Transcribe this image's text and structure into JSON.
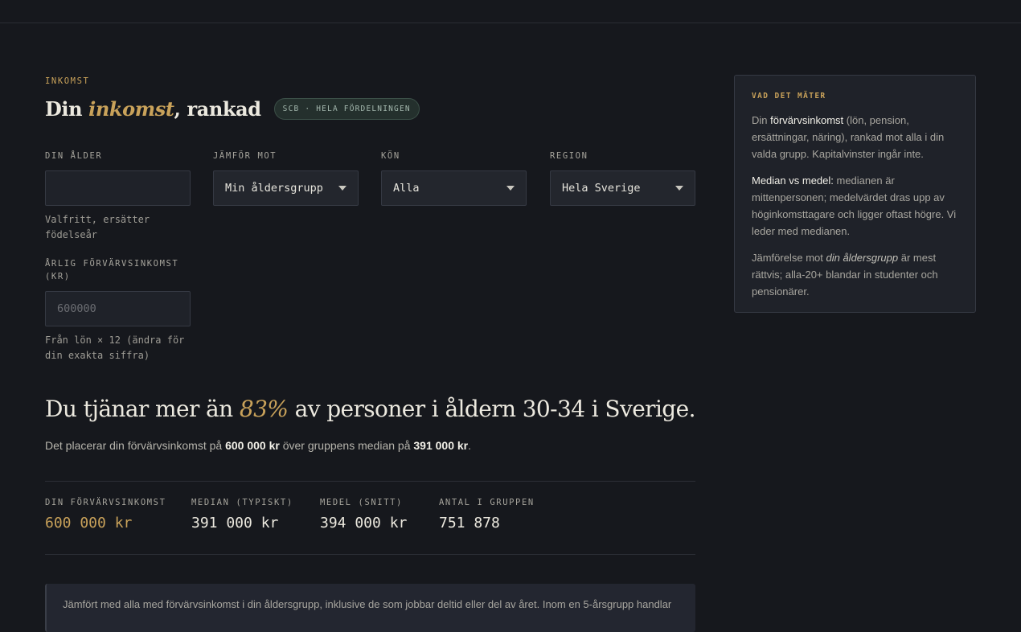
{
  "section": {
    "eyebrow": "INKOMST",
    "title_pre": "Din ",
    "title_em": "inkomst",
    "title_post": ", rankad",
    "source_pill": "SCB · HELA FÖRDELNINGEN"
  },
  "form": {
    "age": {
      "label": "DIN ÅLDER",
      "value": "",
      "placeholder": "",
      "help": "Valfritt, ersätter födelseår"
    },
    "compare": {
      "label": "JÄMFÖR MOT",
      "selected": "Min åldersgrupp"
    },
    "gender": {
      "label": "KÖN",
      "selected": "Alla"
    },
    "region": {
      "label": "REGION",
      "selected": "Hela Sverige"
    },
    "income": {
      "label": "ÅRLIG FÖRVÄRVSINKOMST (KR)",
      "value": "",
      "placeholder": "600000",
      "help": "Från lön × 12 (ändra för din exakta siffra)"
    }
  },
  "result": {
    "headline_pre": "Du tjänar mer än ",
    "headline_pct": "83%",
    "headline_post": " av personer i åldern 30-34 i Sverige.",
    "sub_pre": "Det placerar din förvärvsinkomst på ",
    "sub_income": "600 000 kr",
    "sub_mid": " över gruppens median på ",
    "sub_median": "391 000 kr",
    "sub_end": "."
  },
  "stats": [
    {
      "label": "DIN FÖRVÄRVSINKOMST",
      "value": "600 000 kr"
    },
    {
      "label": "MEDIAN (TYPISKT)",
      "value": "391 000 kr"
    },
    {
      "label": "MEDEL (SNITT)",
      "value": "394 000 kr"
    },
    {
      "label": "ANTAL I GRUPPEN",
      "value": "751 878"
    }
  ],
  "note": "Jämfört med alla med förvärvsinkomst i din åldersgrupp, inklusive de som jobbar deltid eller del av året. Inom en 5-årsgrupp handlar",
  "aside": {
    "head": "VAD DET MÄTER",
    "p1_pre": "Din ",
    "p1_bold": "förvärvsinkomst",
    "p1_post": " (lön, pension, ersättningar, näring), rankad mot alla i din valda grupp. Kapitalvinster ingår inte.",
    "p2_bold": "Median vs medel:",
    "p2_post": " medianen är mittenpersonen; medelvärdet dras upp av höginkomsttagare och ligger oftast högre. Vi leder med medianen.",
    "p3_pre": "Jämförelse mot ",
    "p3_em": "din åldersgrupp",
    "p3_post": " är mest rättvis; alla-20+ blandar in studenter och pensionärer."
  },
  "colors": {
    "accent": "#c9a25a",
    "background": "#16181d",
    "panel": "#1f2229"
  }
}
